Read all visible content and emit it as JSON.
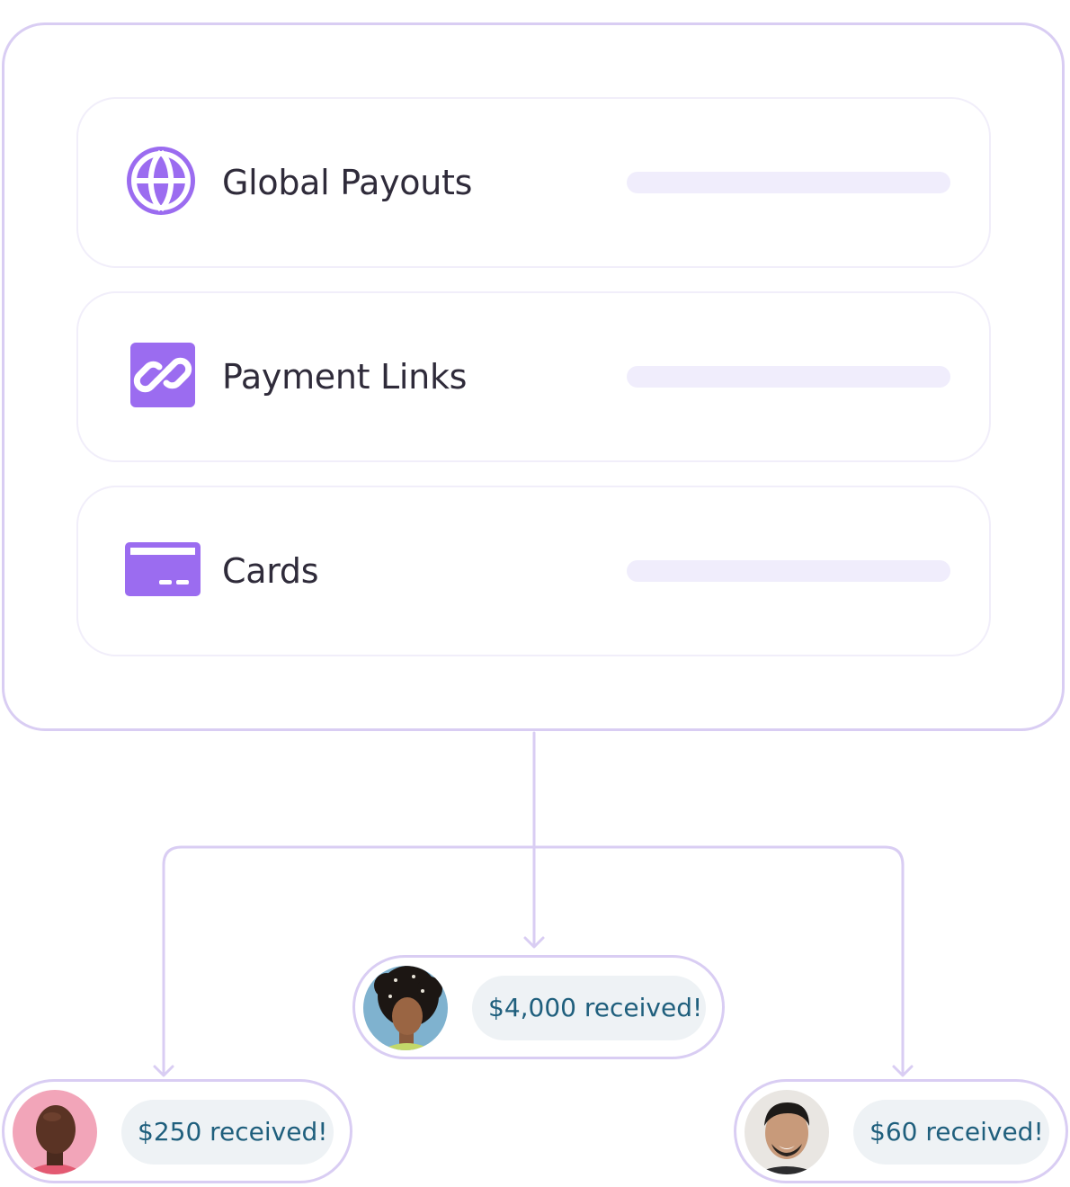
{
  "colors": {
    "accent": "#9b6cf0",
    "border": "#d9cdf3",
    "placeholder_bar": "#f0edfc",
    "amount_bg": "#eef2f5",
    "amount_text": "#1f5f7d"
  },
  "features": [
    {
      "label": "Global Payouts",
      "icon": "globe-icon"
    },
    {
      "label": "Payment Links",
      "icon": "link-icon"
    },
    {
      "label": "Cards",
      "icon": "credit-card-icon"
    }
  ],
  "recipients": [
    {
      "amount": "$4,000 received!",
      "avatar": "avatar-woman-curly-hair"
    },
    {
      "amount": "$250 received!",
      "avatar": "avatar-man-bald"
    },
    {
      "amount": "$60 received!",
      "avatar": "avatar-man-smiling"
    }
  ]
}
